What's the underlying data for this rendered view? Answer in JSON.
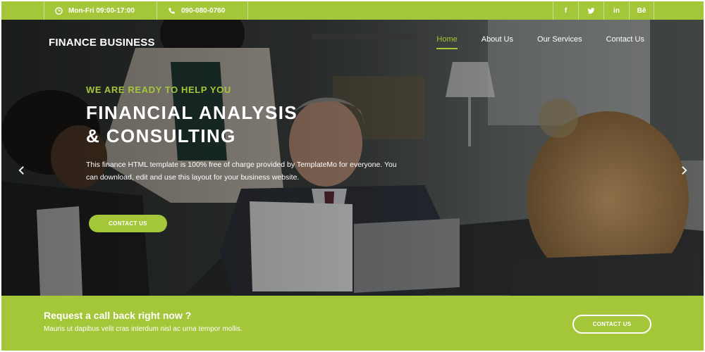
{
  "colors": {
    "accent": "#a4c639",
    "text_light": "#ffffff"
  },
  "topbar": {
    "hours": {
      "icon": "clock-icon",
      "text": "Mon-Fri 09:00-17:00"
    },
    "phone": {
      "icon": "phone-icon",
      "text": "090-080-0760"
    },
    "socials": [
      {
        "icon": "facebook-icon",
        "label": "f"
      },
      {
        "icon": "twitter-icon",
        "label": "🐦"
      },
      {
        "icon": "linkedin-icon",
        "label": "in"
      },
      {
        "icon": "behance-icon",
        "label": "Bē"
      }
    ]
  },
  "header": {
    "logo": "FINANCE BUSINESS",
    "nav": [
      {
        "label": "Home",
        "active": true
      },
      {
        "label": "About Us",
        "active": false
      },
      {
        "label": "Our Services",
        "active": false
      },
      {
        "label": "Contact Us",
        "active": false
      }
    ]
  },
  "hero": {
    "eyebrow": "WE ARE READY TO HELP YOU",
    "headline_line1": "FINANCIAL ANALYSIS",
    "headline_line2": "& CONSULTING",
    "description": "This finance HTML template is 100% free of charge provided by TemplateMo for everyone. You can download, edit and use this layout for your business website.",
    "button_label": "CONTACT US",
    "prev_icon": "chevron-left-icon",
    "next_icon": "chevron-right-icon"
  },
  "callback": {
    "title": "Request a call back right now ?",
    "text": "Mauris ut dapibus velit cras interdum nisl ac urna tempor mollis.",
    "button_label": "CONTACT US"
  }
}
